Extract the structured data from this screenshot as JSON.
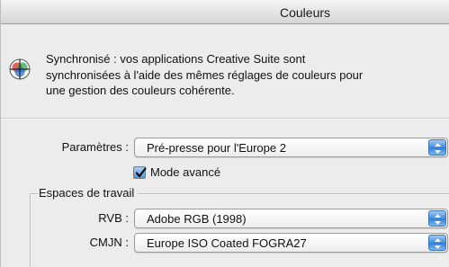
{
  "window": {
    "title": "Couleurs"
  },
  "sync": {
    "icon": "color-wheel-icon",
    "lines": [
      "Synchronisé : vos applications Creative Suite sont",
      "synchronisées à l'aide des mêmes réglages de couleurs pour",
      "une gestion des couleurs cohérente."
    ]
  },
  "settings": {
    "label": "Paramètres :",
    "value": "Pré-presse pour l'Europe 2"
  },
  "advanced_mode": {
    "label": "Mode avancé",
    "checked": true
  },
  "working_spaces": {
    "title": "Espaces de travail",
    "rgb": {
      "label": "RVB :",
      "value": "Adobe RGB (1998)"
    },
    "cmyk": {
      "label": "CMJN :",
      "value": "Europe ISO Coated FOGRA27"
    }
  },
  "colors": {
    "window_bg": "#ececec",
    "accent_blue": "#3f8ee0"
  }
}
